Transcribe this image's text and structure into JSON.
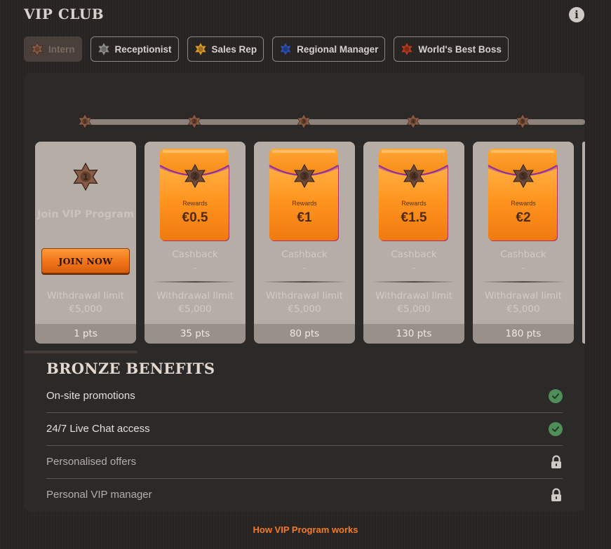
{
  "header": {
    "title": "VIP CLUB",
    "info_icon": "info-icon"
  },
  "tiers": [
    {
      "label": "Intern",
      "color": "#8a5a44",
      "active": true
    },
    {
      "label": "Receptionist",
      "color": "#8e8e8e",
      "active": false
    },
    {
      "label": "Sales Rep",
      "color": "#d99a2b",
      "active": false
    },
    {
      "label": "Regional Manager",
      "color": "#2d4fb0",
      "active": false
    },
    {
      "label": "World's Best Boss",
      "color": "#b83a1e",
      "active": false
    }
  ],
  "track": {
    "levels": [
      "1",
      "2",
      "3",
      "4",
      "5"
    ]
  },
  "join_card": {
    "level": "1",
    "title": "Join VIP Program",
    "button": "JOIN NOW",
    "withdrawal_label": "Withdrawal limit",
    "withdrawal_value": "€5,000",
    "points": "1 pts"
  },
  "cards": [
    {
      "level": "2",
      "rewards_label": "Rewards",
      "rewards": "€0.5",
      "cashback_label": "Cashback",
      "cashback": "-",
      "withdrawal_label": "Withdrawal limit",
      "withdrawal_value": "€5,000",
      "points": "35 pts"
    },
    {
      "level": "3",
      "rewards_label": "Rewards",
      "rewards": "€1",
      "cashback_label": "Cashback",
      "cashback": "-",
      "withdrawal_label": "Withdrawal limit",
      "withdrawal_value": "€5,000",
      "points": "80 pts"
    },
    {
      "level": "4",
      "rewards_label": "Rewards",
      "rewards": "€1.5",
      "cashback_label": "Cashback",
      "cashback": "-",
      "withdrawal_label": "Withdrawal limit",
      "withdrawal_value": "€5,000",
      "points": "130 pts"
    },
    {
      "level": "5",
      "rewards_label": "Rewards",
      "rewards": "€2",
      "cashback_label": "Cashback",
      "cashback": "-",
      "withdrawal_label": "Withdrawal limit",
      "withdrawal_value": "€5,000",
      "points": "180 pts"
    }
  ],
  "benefits": {
    "title": "BRONZE BENEFITS",
    "items": [
      {
        "label": "On-site promotions",
        "status": "unlocked",
        "icon": "check-icon"
      },
      {
        "label": "24/7 Live Chat access",
        "status": "unlocked",
        "icon": "check-icon"
      },
      {
        "label": "Personalised offers",
        "status": "locked",
        "icon": "lock-icon"
      },
      {
        "label": "Personal VIP manager",
        "status": "locked",
        "icon": "lock-icon"
      }
    ]
  },
  "footer": {
    "link": "How VIP Program works"
  },
  "colors": {
    "accent": "#f47b20",
    "check": "#4e8e58",
    "bronze": "#8a5a44"
  }
}
